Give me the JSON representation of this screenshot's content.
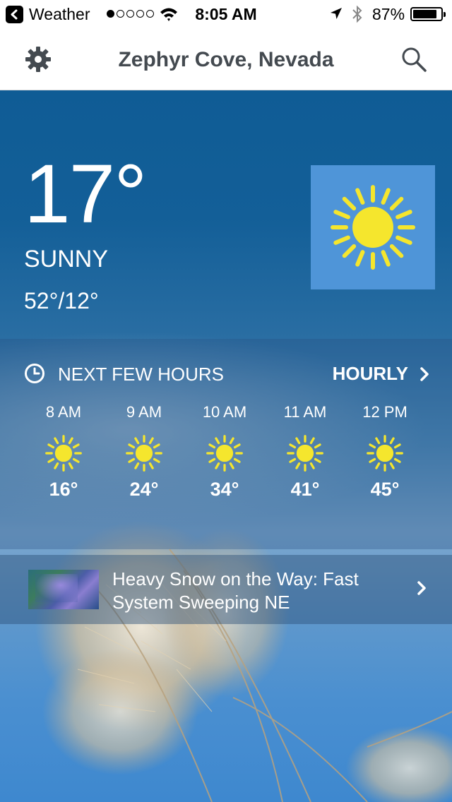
{
  "status_bar": {
    "back_app": "Weather",
    "signal_dots": 5,
    "signal_filled": 1,
    "time": "8:05 AM",
    "battery_percent": "87%",
    "battery_level": 0.87
  },
  "nav": {
    "title": "Zephyr Cove, Nevada",
    "settings_icon": "gear-icon",
    "search_icon": "search-icon"
  },
  "current": {
    "temperature": "17°",
    "condition": "SUNNY",
    "hi_lo": "52°/12°",
    "icon": "sun-icon"
  },
  "hourly": {
    "label": "NEXT FEW HOURS",
    "link_label": "HOURLY",
    "hours": [
      {
        "time": "8 AM",
        "temp": "16°",
        "icon": "sun-icon"
      },
      {
        "time": "9 AM",
        "temp": "24°",
        "icon": "sun-icon"
      },
      {
        "time": "10 AM",
        "temp": "34°",
        "icon": "sun-icon"
      },
      {
        "time": "11 AM",
        "temp": "41°",
        "icon": "sun-icon"
      },
      {
        "time": "12 PM",
        "temp": "45°",
        "icon": "sun-icon"
      }
    ]
  },
  "news": {
    "headline": "Heavy Snow on the Way: Fast System Sweeping NE"
  },
  "colors": {
    "sun_yellow": "#f5e62d",
    "sun_tile": "#4f95d8",
    "nav_text": "#444a50"
  }
}
